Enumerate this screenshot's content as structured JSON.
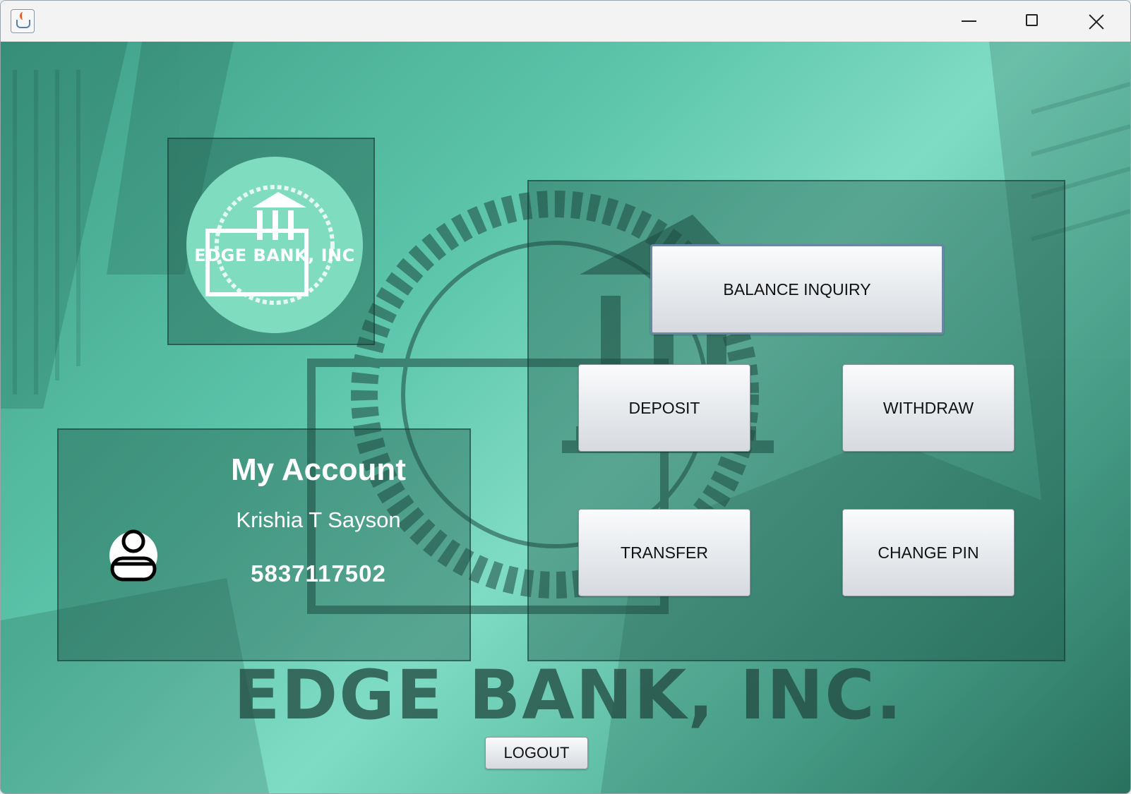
{
  "window": {
    "app_icon": "java-cup-icon",
    "controls": [
      "minimize-icon",
      "maximize-icon",
      "close-icon"
    ]
  },
  "logo": {
    "text": "EDGE BANK, INC"
  },
  "account": {
    "title": "My Account",
    "name": "Krishia T Sayson",
    "number": "5837117502",
    "icon": "user-icon"
  },
  "actions": {
    "balance_inquiry": "BALANCE INQUIRY",
    "deposit": "DEPOSIT",
    "withdraw": "WITHDRAW",
    "transfer": "TRANSFER",
    "change_pin": "CHANGE PIN"
  },
  "watermark": "EDGE BANK, INC.",
  "logout": "LOGOUT",
  "colors": {
    "background_teal": "#5cc5aa",
    "logo_circle": "#7fdcbf",
    "panel_dark": "#1f5a4a"
  }
}
